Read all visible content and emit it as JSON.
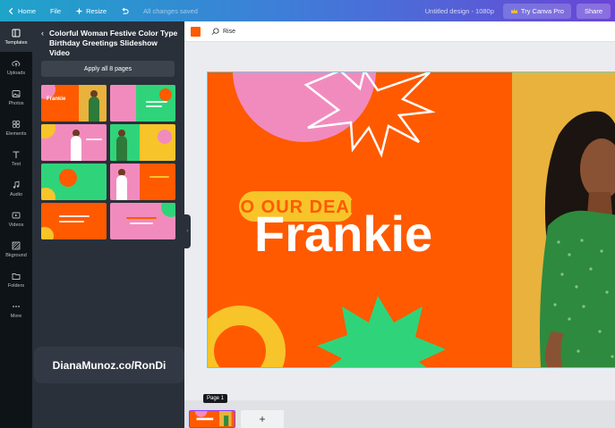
{
  "topbar": {
    "home": "Home",
    "file": "File",
    "resize": "Resize",
    "status": "All changes saved",
    "doc_title": "Untitled design - 1080p",
    "try_pro": "Try Canva Pro",
    "share": "Share"
  },
  "rail": {
    "items": [
      {
        "label": "Templates",
        "icon": "templates-icon"
      },
      {
        "label": "Uploads",
        "icon": "upload-icon"
      },
      {
        "label": "Photos",
        "icon": "photos-icon"
      },
      {
        "label": "Elements",
        "icon": "elements-icon"
      },
      {
        "label": "Text",
        "icon": "text-icon"
      },
      {
        "label": "Audio",
        "icon": "audio-icon"
      },
      {
        "label": "Videos",
        "icon": "video-icon"
      },
      {
        "label": "Bkground",
        "icon": "background-icon"
      },
      {
        "label": "Folders",
        "icon": "folder-icon"
      },
      {
        "label": "More",
        "icon": "more-icon"
      }
    ]
  },
  "panel": {
    "title": "Colorful Woman Festive Color Type Birthday Greetings Slideshow Video",
    "apply_all": "Apply all 8 pages",
    "thumb_label": "Frankie"
  },
  "watermark": "DianaMunoz.co/RonDi",
  "toolbar": {
    "accent_color": "#ff5a00",
    "animate": "Rise"
  },
  "slide": {
    "tagline": "TO OUR DEAR",
    "name": "Frankie",
    "colors": {
      "orange": "#ff5a00",
      "pink": "#f28bbd",
      "yellow": "#f7c42a",
      "green": "#2fd47a",
      "mustard": "#e8b23d"
    }
  },
  "bottom": {
    "page_tooltip": "Page 1",
    "add_page": "+"
  }
}
